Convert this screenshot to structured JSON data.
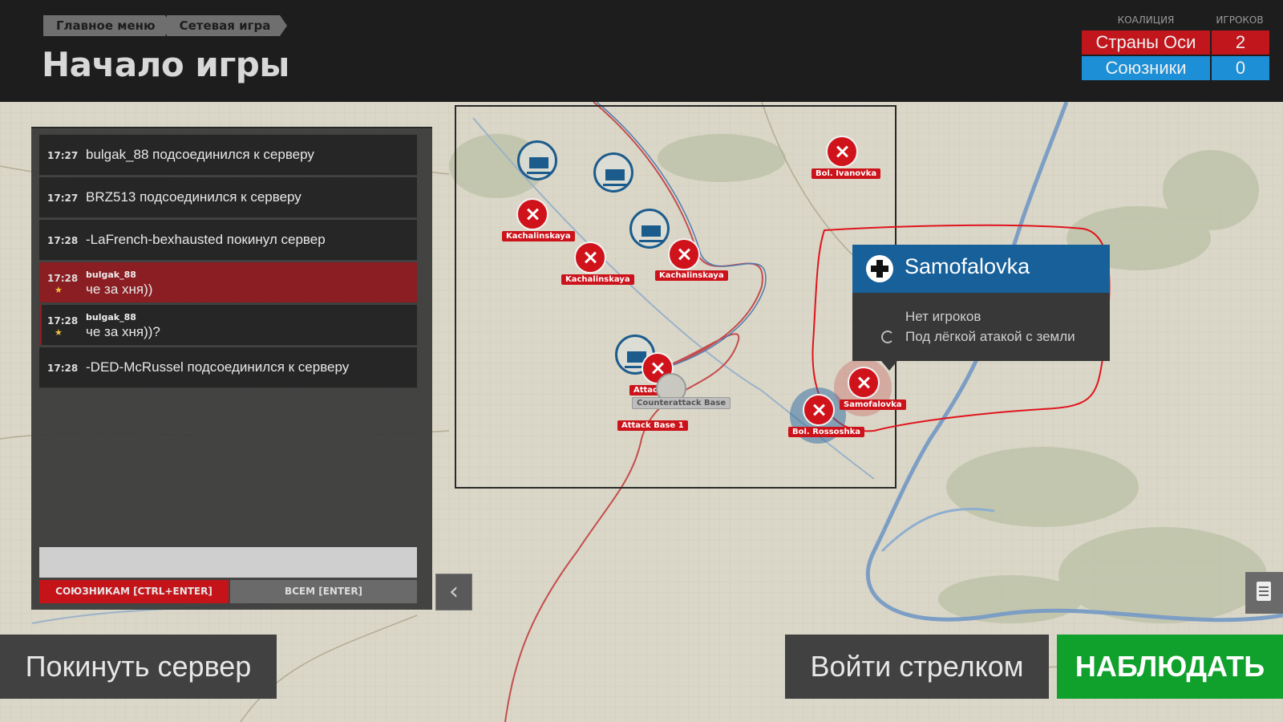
{
  "breadcrumb": [
    "Главное меню",
    "Сетевая игра"
  ],
  "title": "Начало игры",
  "coalitions": {
    "header_coalition": "КОАЛИЦИЯ",
    "header_players": "ИГРОКОВ",
    "axis": {
      "name": "Страны Оси",
      "players": "2",
      "color": "#c2161d"
    },
    "allies": {
      "name": "Союзники",
      "players": "0",
      "color": "#1d8fd6"
    }
  },
  "chat": {
    "messages": [
      {
        "time": "17:27",
        "text": "bulgak_88 подсоединился к серверу"
      },
      {
        "time": "17:27",
        "text": "BRZ513 подсоединился к серверу"
      },
      {
        "time": "17:28",
        "text": "-LaFrench-bexhausted покинул сервер"
      },
      {
        "time": "17:28",
        "user": "bulgak_88",
        "text": "че за хня))"
      },
      {
        "time": "17:28",
        "user": "bulgak_88",
        "text": "че за хня))?"
      },
      {
        "time": "17:28",
        "text": "-DED-McRussel подсоединился к серверу"
      }
    ],
    "input_value": "",
    "send_allies": "СОЮЗНИКАМ [CTRL+ENTER]",
    "send_all": "ВСЕМ [ENTER]"
  },
  "map": {
    "markers": [
      {
        "label": "Bol. Ivanovka",
        "type": "airfield"
      },
      {
        "label": "Kachalinskaya",
        "type": "airfield"
      },
      {
        "label": "Kachalinskaya",
        "type": "airfield"
      },
      {
        "label": "Kachalinskaya",
        "type": "airfield"
      },
      {
        "label": "Attack",
        "type": "airfield"
      },
      {
        "label": "Counterattack Base",
        "type": "base"
      },
      {
        "label": "Attack Base 1",
        "type": "airfield"
      },
      {
        "label": "Samofalovka",
        "type": "airfield"
      },
      {
        "label": "Bol. Rossoshka",
        "type": "airfield"
      }
    ]
  },
  "tooltip": {
    "title": "Samofalovka",
    "line1": "Нет игроков",
    "line2": "Под лёгкой атакой с земли"
  },
  "buttons": {
    "leave": "Покинуть сервер",
    "gunner": "Войти стрелком",
    "watch": "НАБЛЮДАТЬ"
  }
}
